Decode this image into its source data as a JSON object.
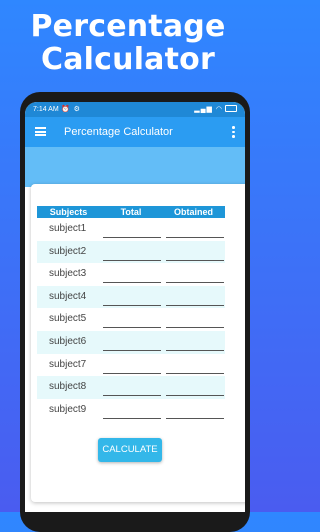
{
  "promo": {
    "line1": "Percentage",
    "line2": "Calculator"
  },
  "status_bar": {
    "time": "7:14 AM"
  },
  "app_bar": {
    "title": "Percentage Calculator"
  },
  "table": {
    "headers": [
      "Subjects",
      "Total",
      "Obtained"
    ],
    "rows": [
      {
        "subject": "subject1",
        "total": "",
        "obtained": ""
      },
      {
        "subject": "subject2",
        "total": "",
        "obtained": ""
      },
      {
        "subject": "subject3",
        "total": "",
        "obtained": ""
      },
      {
        "subject": "subject4",
        "total": "",
        "obtained": ""
      },
      {
        "subject": "subject5",
        "total": "",
        "obtained": ""
      },
      {
        "subject": "subject6",
        "total": "",
        "obtained": ""
      },
      {
        "subject": "subject7",
        "total": "",
        "obtained": ""
      },
      {
        "subject": "subject8",
        "total": "",
        "obtained": ""
      },
      {
        "subject": "subject9",
        "total": "",
        "obtained": ""
      }
    ]
  },
  "calculate_button": "CALCULATE",
  "colors": {
    "background_top": "#2f87ff",
    "background_bottom": "#4a5cf0",
    "app_bar": "#2b9cf2",
    "status_bar": "#1f88d6",
    "header_band": "#63bdf7",
    "table_header": "#1e96d8",
    "row_shade": "#e6f9fb",
    "button": "#33b7e9"
  },
  "icons": [
    "menu-icon",
    "more-vert-icon",
    "wifi-icon",
    "signal-icon",
    "battery-icon",
    "alarm-icon",
    "settings-icon"
  ]
}
